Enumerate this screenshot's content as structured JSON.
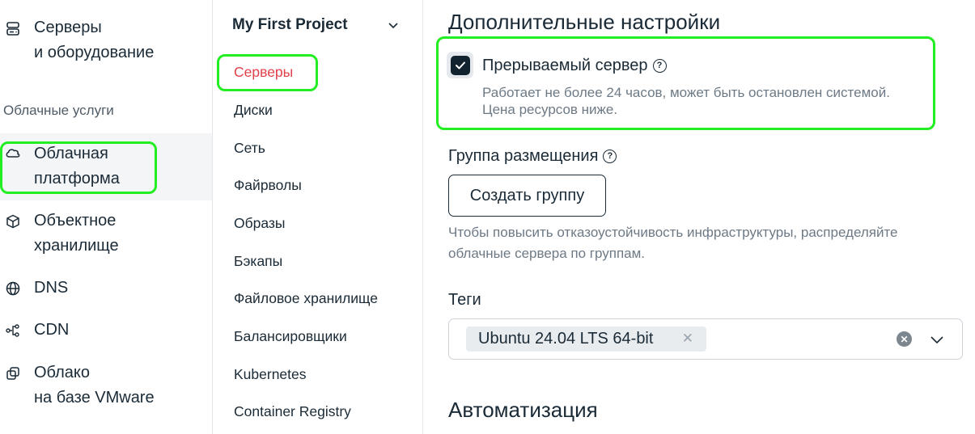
{
  "sidebar_left": {
    "items": [
      {
        "icon": "server-icon",
        "label_line1": "Серверы",
        "label_line2": "и оборудование"
      },
      {
        "icon": "cloud-icon",
        "label_line1": "Облачная",
        "label_line2": "платформа",
        "active": true
      },
      {
        "icon": "cube-icon",
        "label_line1": "Объектное",
        "label_line2": "хранилище"
      },
      {
        "icon": "globe-icon",
        "label_line1": "DNS"
      },
      {
        "icon": "cdn-icon",
        "label_line1": "CDN"
      },
      {
        "icon": "vmware-icon",
        "label_line1": "Облако",
        "label_line2": "на базе VMware"
      }
    ],
    "section_label": "Облачные услуги"
  },
  "sidebar_mid": {
    "project_name": "My First Project",
    "items": [
      {
        "label": "Серверы",
        "active": true
      },
      {
        "label": "Диски"
      },
      {
        "label": "Сеть"
      },
      {
        "label": "Файрволы"
      },
      {
        "label": "Образы"
      },
      {
        "label": "Бэкапы"
      },
      {
        "label": "Файловое хранилище"
      },
      {
        "label": "Балансировщики"
      },
      {
        "label": "Kubernetes"
      },
      {
        "label": "Container Registry"
      }
    ]
  },
  "main": {
    "additional_settings_title": "Дополнительные настройки",
    "preemptible": {
      "label": "Прерываемый сервер",
      "checked": true,
      "description_line1": "Работает не более 24 часов, может быть остановлен системой.",
      "description_line2": "Цена ресурсов ниже."
    },
    "placement_group": {
      "label": "Группа размещения",
      "button_label": "Создать группу",
      "hint_line1": "Чтобы повысить отказоустойчивость инфраструктуры, распределяйте",
      "hint_line2": "облачные сервера по группам."
    },
    "tags": {
      "label": "Теги",
      "selected": [
        "Ubuntu 24.04 LTS 64-bit"
      ]
    },
    "automation_title": "Автоматизация"
  },
  "colors": {
    "accent_red": "#e2404b",
    "highlight_green": "#22ee22",
    "text_dark": "#1a2a36",
    "text_muted": "#6d7a86"
  }
}
